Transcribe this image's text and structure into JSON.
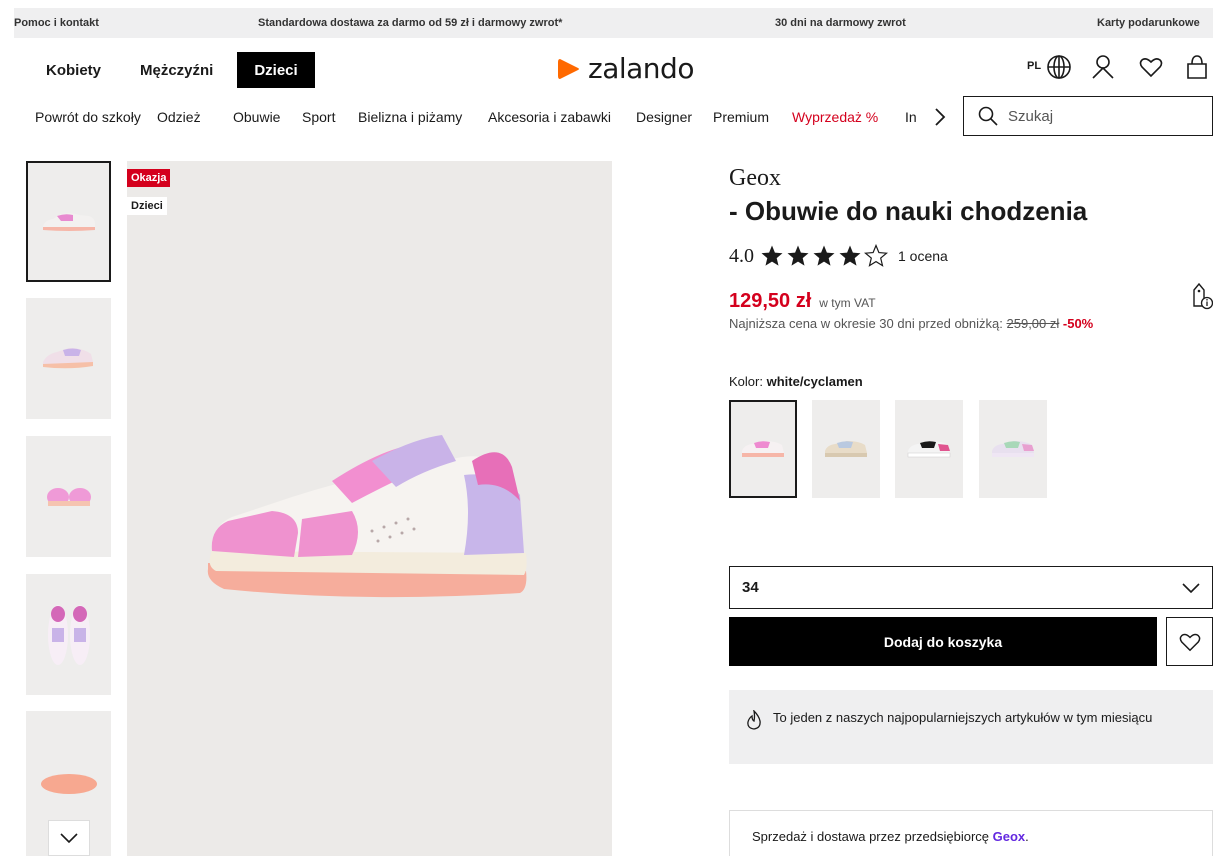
{
  "topbar": {
    "help": "Pomoc i kontakt",
    "shipping": "Standardowa dostawa za darmo od 59 zł i darmowy zwrot*",
    "returns": "30 dni na darmowy zwrot",
    "giftcards": "Karty podarunkowe"
  },
  "header": {
    "genders": [
      "Kobiety",
      "Mężczyźni",
      "Dzieci"
    ],
    "active_gender": "Dzieci",
    "logo_text": "zalando",
    "lang": "PL",
    "accent": "#ff6900"
  },
  "categories": [
    "Powrót do szkoły",
    "Odzież",
    "Obuwie",
    "Sport",
    "Bielizna i piżamy",
    "Akcesoria i zabawki",
    "Designer",
    "Premium",
    "Wyprzedaż %",
    "In"
  ],
  "search": {
    "placeholder": "Szukaj"
  },
  "image": {
    "flags": [
      "Okazja",
      "Dzieci"
    ]
  },
  "product": {
    "brand": "Geox",
    "title": "- Obuwie do nauki chodzenia",
    "rating": "4.0",
    "rating_value": 4,
    "rating_count": "1 ocena",
    "price": "129,50 zł",
    "vat": "w tym VAT",
    "lowest_label": "Najniższa cena w okresie 30 dni przed obniżką:",
    "old_price": "259,00 zł",
    "discount": "-50%",
    "color_label": "Kolor:",
    "color_value": "white/cyclamen",
    "size": "34",
    "add_to_cart": "Dodaj do koszyka",
    "popular_note": "To jeden z naszych najpopularniejszych artykułów w tym miesiącu",
    "seller_text": "Sprzedaż i dostawa przez przedsiębiorcę",
    "seller_name": "Geox",
    "seller_end": "."
  },
  "colors": {
    "sale": "#d4001d",
    "seller_link": "#6328e0"
  }
}
